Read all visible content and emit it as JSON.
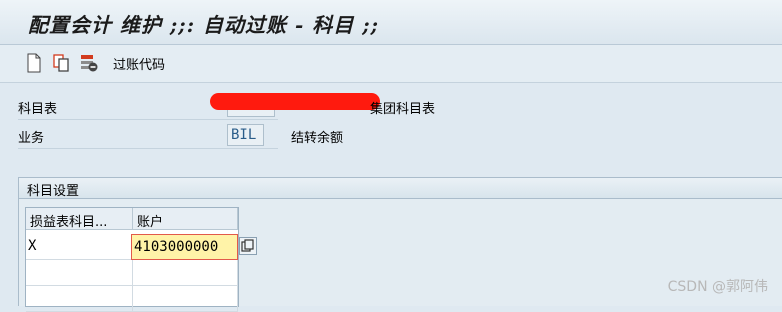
{
  "window": {
    "title": "配置会计 维护 ;;: 自动过账 - 科目 ;;"
  },
  "toolbar": {
    "posting_key_label": "过账代码"
  },
  "fields": {
    "coa_label": "科目表",
    "coa_desc_suffix": "集团科目表",
    "transaction_label": "业务",
    "transaction_value": "BIL",
    "transaction_desc": "结转余额"
  },
  "account_assignment": {
    "group_title": "科目设置",
    "columns": [
      "损益表科目...",
      "账户"
    ],
    "rows": [
      {
        "pl_type": "X",
        "account": "4103000000"
      }
    ]
  },
  "watermark": "CSDN @郭阿伟"
}
